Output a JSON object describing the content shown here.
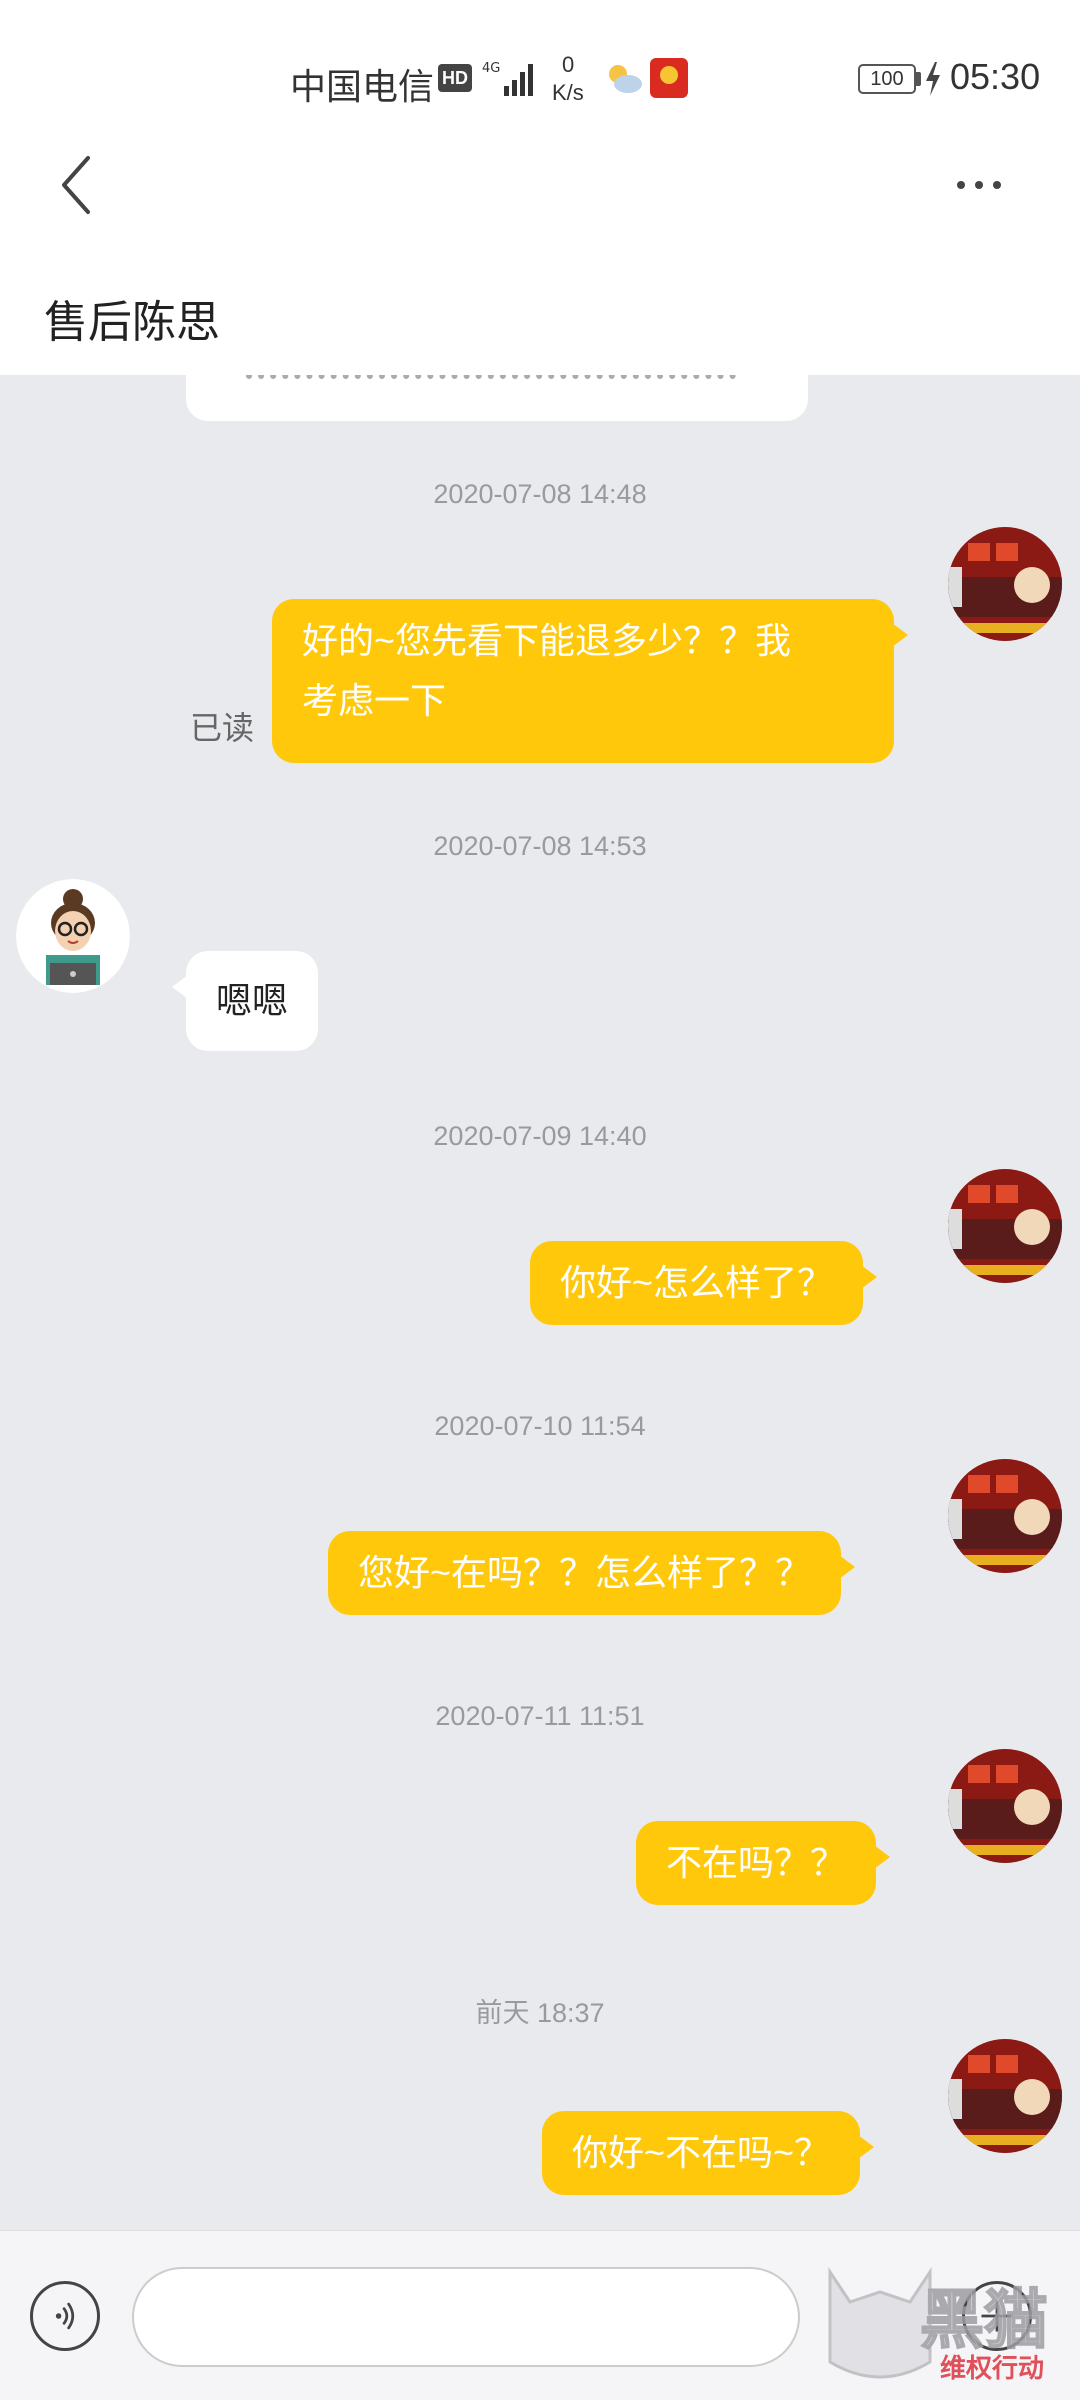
{
  "status_bar": {
    "carrier": "中国电信",
    "hd_badge": "HD",
    "network": "4G",
    "speed_value": "0",
    "speed_unit": "K/s",
    "battery": "100",
    "time": "05:30"
  },
  "header": {
    "back_icon": "chevron-left-icon",
    "more_icon": "more-horizontal-icon",
    "title": "售后陈思"
  },
  "messages": [
    {
      "type": "timestamp",
      "text": "2020-07-08 14:48"
    },
    {
      "type": "outgoing",
      "lines": [
        "好的~您先看下能退多少？？我",
        "考虑一下"
      ],
      "status": "已读"
    },
    {
      "type": "timestamp",
      "text": "2020-07-08 14:53"
    },
    {
      "type": "incoming",
      "text": "嗯嗯"
    },
    {
      "type": "timestamp",
      "text": "2020-07-09 14:40"
    },
    {
      "type": "outgoing",
      "text": "你好~怎么样了？"
    },
    {
      "type": "timestamp",
      "text": "2020-07-10 11:54"
    },
    {
      "type": "outgoing",
      "text": "您好~在吗？？怎么样了？？"
    },
    {
      "type": "timestamp",
      "text": "2020-07-11 11:51"
    },
    {
      "type": "outgoing",
      "text": "不在吗？？"
    },
    {
      "type": "timestamp",
      "text": "前天 18:37"
    },
    {
      "type": "outgoing",
      "text": "你好~不在吗~？"
    }
  ],
  "input_bar": {
    "voice_icon": "voice-icon",
    "input_value": "",
    "input_placeholder": "",
    "plus_icon": "plus-icon"
  },
  "watermark": {
    "logo_text": "黑猫",
    "slogan": "维权行动"
  },
  "colors": {
    "outgoing_bubble": "#ffc80a",
    "incoming_bubble": "#ffffff",
    "chat_background": "#e9eaee",
    "timestamp_text": "#9a9a9e"
  }
}
